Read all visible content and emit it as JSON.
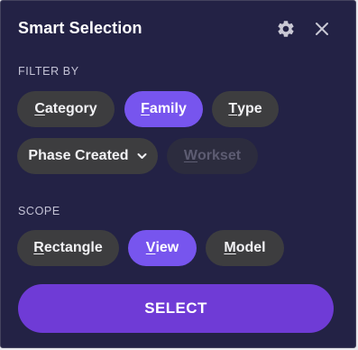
{
  "header": {
    "title": "Smart Selection",
    "settings_icon": "gear-icon",
    "close_icon": "close-icon"
  },
  "filter": {
    "label": "FILTER BY",
    "chips": [
      {
        "accel": "C",
        "rest": "ategory",
        "active": false,
        "enabled": true
      },
      {
        "accel": "F",
        "rest": "amily",
        "active": true,
        "enabled": true
      },
      {
        "accel": "T",
        "rest": "ype",
        "active": false,
        "enabled": true
      }
    ],
    "phase_dropdown": {
      "label": "Phase Created",
      "icon": "chevron-down-icon"
    },
    "workset": {
      "accel": "W",
      "rest": "orkset",
      "enabled": false
    }
  },
  "scope": {
    "label": "SCOPE",
    "chips": [
      {
        "accel": "R",
        "rest": "ectangle",
        "active": false
      },
      {
        "accel": "V",
        "rest": "iew",
        "active": true
      },
      {
        "accel": "M",
        "rest": "odel",
        "active": false
      }
    ]
  },
  "action": {
    "select_label": "SELECT"
  },
  "colors": {
    "panel_bg": "#232245",
    "chip_bg": "#3d3d3f",
    "chip_active": "#7755ee",
    "primary_button": "#6f3bd6",
    "disabled_text": "#5d5c72"
  }
}
